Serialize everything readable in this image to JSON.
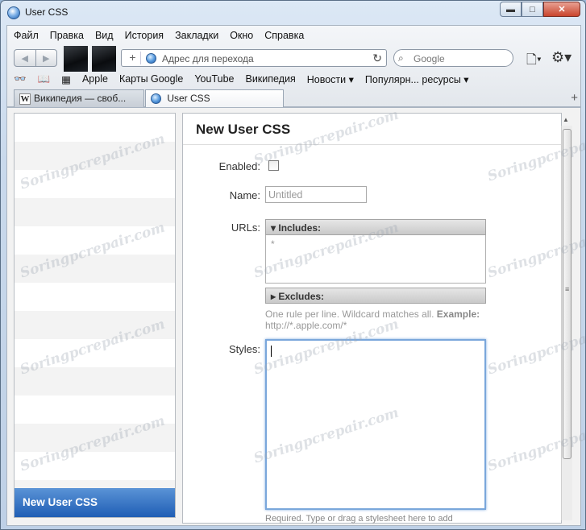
{
  "window": {
    "title": "User CSS",
    "controls": {
      "minimize": "▬",
      "maximize": "□",
      "close": "✕"
    }
  },
  "menu": [
    "Файл",
    "Правка",
    "Вид",
    "История",
    "Закладки",
    "Окно",
    "Справка"
  ],
  "navbar": {
    "back": "◀",
    "forward": "▶",
    "url_placeholder": "Адрес для перехода",
    "search_placeholder": "Google"
  },
  "bookmarks": [
    "Apple",
    "Карты Google",
    "YouTube",
    "Википедия",
    "Новости ▾",
    "Популярн... ресурсы ▾"
  ],
  "tabs": [
    {
      "label": "Википедия — своб..."
    },
    {
      "label": "User CSS"
    }
  ],
  "new_tab": "+",
  "sidebar": {
    "selected": "New User CSS"
  },
  "panel": {
    "title": "New User CSS",
    "enabled_label": "Enabled:",
    "name_label": "Name:",
    "name_placeholder": "Untitled",
    "urls_label": "URLs:",
    "includes_label": "▾ Includes:",
    "includes_value": "*",
    "excludes_label": "▸ Excludes:",
    "hint": "One rule per line. Wildcard matches all.",
    "hint_example_label": "Example:",
    "hint_example": "http://*.apple.com/*",
    "styles_label": "Styles:",
    "required_note": "Required. Type or drag a stylesheet here to add"
  },
  "watermark": "Soringpcrepair.com"
}
